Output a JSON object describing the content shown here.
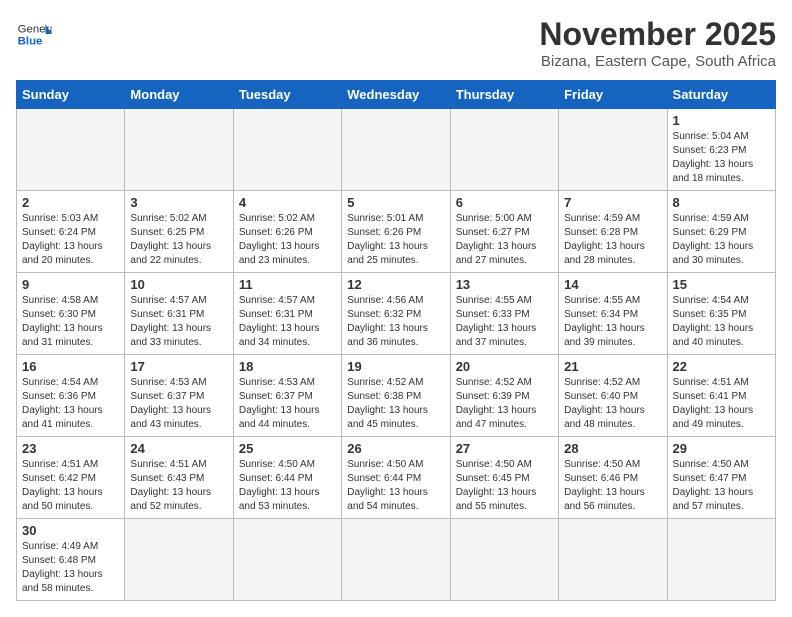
{
  "header": {
    "logo_text_general": "General",
    "logo_text_blue": "Blue",
    "month": "November 2025",
    "location": "Bizana, Eastern Cape, South Africa"
  },
  "days_of_week": [
    "Sunday",
    "Monday",
    "Tuesday",
    "Wednesday",
    "Thursday",
    "Friday",
    "Saturday"
  ],
  "weeks": [
    [
      {
        "day": "",
        "info": "",
        "empty": true
      },
      {
        "day": "",
        "info": "",
        "empty": true
      },
      {
        "day": "",
        "info": "",
        "empty": true
      },
      {
        "day": "",
        "info": "",
        "empty": true
      },
      {
        "day": "",
        "info": "",
        "empty": true
      },
      {
        "day": "",
        "info": "",
        "empty": true
      },
      {
        "day": "1",
        "info": "Sunrise: 5:04 AM\nSunset: 6:23 PM\nDaylight: 13 hours and 18 minutes."
      }
    ],
    [
      {
        "day": "2",
        "info": "Sunrise: 5:03 AM\nSunset: 6:24 PM\nDaylight: 13 hours and 20 minutes."
      },
      {
        "day": "3",
        "info": "Sunrise: 5:02 AM\nSunset: 6:25 PM\nDaylight: 13 hours and 22 minutes."
      },
      {
        "day": "4",
        "info": "Sunrise: 5:02 AM\nSunset: 6:26 PM\nDaylight: 13 hours and 23 minutes."
      },
      {
        "day": "5",
        "info": "Sunrise: 5:01 AM\nSunset: 6:26 PM\nDaylight: 13 hours and 25 minutes."
      },
      {
        "day": "6",
        "info": "Sunrise: 5:00 AM\nSunset: 6:27 PM\nDaylight: 13 hours and 27 minutes."
      },
      {
        "day": "7",
        "info": "Sunrise: 4:59 AM\nSunset: 6:28 PM\nDaylight: 13 hours and 28 minutes."
      },
      {
        "day": "8",
        "info": "Sunrise: 4:59 AM\nSunset: 6:29 PM\nDaylight: 13 hours and 30 minutes."
      }
    ],
    [
      {
        "day": "9",
        "info": "Sunrise: 4:58 AM\nSunset: 6:30 PM\nDaylight: 13 hours and 31 minutes."
      },
      {
        "day": "10",
        "info": "Sunrise: 4:57 AM\nSunset: 6:31 PM\nDaylight: 13 hours and 33 minutes."
      },
      {
        "day": "11",
        "info": "Sunrise: 4:57 AM\nSunset: 6:31 PM\nDaylight: 13 hours and 34 minutes."
      },
      {
        "day": "12",
        "info": "Sunrise: 4:56 AM\nSunset: 6:32 PM\nDaylight: 13 hours and 36 minutes."
      },
      {
        "day": "13",
        "info": "Sunrise: 4:55 AM\nSunset: 6:33 PM\nDaylight: 13 hours and 37 minutes."
      },
      {
        "day": "14",
        "info": "Sunrise: 4:55 AM\nSunset: 6:34 PM\nDaylight: 13 hours and 39 minutes."
      },
      {
        "day": "15",
        "info": "Sunrise: 4:54 AM\nSunset: 6:35 PM\nDaylight: 13 hours and 40 minutes."
      }
    ],
    [
      {
        "day": "16",
        "info": "Sunrise: 4:54 AM\nSunset: 6:36 PM\nDaylight: 13 hours and 41 minutes."
      },
      {
        "day": "17",
        "info": "Sunrise: 4:53 AM\nSunset: 6:37 PM\nDaylight: 13 hours and 43 minutes."
      },
      {
        "day": "18",
        "info": "Sunrise: 4:53 AM\nSunset: 6:37 PM\nDaylight: 13 hours and 44 minutes."
      },
      {
        "day": "19",
        "info": "Sunrise: 4:52 AM\nSunset: 6:38 PM\nDaylight: 13 hours and 45 minutes."
      },
      {
        "day": "20",
        "info": "Sunrise: 4:52 AM\nSunset: 6:39 PM\nDaylight: 13 hours and 47 minutes."
      },
      {
        "day": "21",
        "info": "Sunrise: 4:52 AM\nSunset: 6:40 PM\nDaylight: 13 hours and 48 minutes."
      },
      {
        "day": "22",
        "info": "Sunrise: 4:51 AM\nSunset: 6:41 PM\nDaylight: 13 hours and 49 minutes."
      }
    ],
    [
      {
        "day": "23",
        "info": "Sunrise: 4:51 AM\nSunset: 6:42 PM\nDaylight: 13 hours and 50 minutes."
      },
      {
        "day": "24",
        "info": "Sunrise: 4:51 AM\nSunset: 6:43 PM\nDaylight: 13 hours and 52 minutes."
      },
      {
        "day": "25",
        "info": "Sunrise: 4:50 AM\nSunset: 6:44 PM\nDaylight: 13 hours and 53 minutes."
      },
      {
        "day": "26",
        "info": "Sunrise: 4:50 AM\nSunset: 6:44 PM\nDaylight: 13 hours and 54 minutes."
      },
      {
        "day": "27",
        "info": "Sunrise: 4:50 AM\nSunset: 6:45 PM\nDaylight: 13 hours and 55 minutes."
      },
      {
        "day": "28",
        "info": "Sunrise: 4:50 AM\nSunset: 6:46 PM\nDaylight: 13 hours and 56 minutes."
      },
      {
        "day": "29",
        "info": "Sunrise: 4:50 AM\nSunset: 6:47 PM\nDaylight: 13 hours and 57 minutes."
      }
    ],
    [
      {
        "day": "30",
        "info": "Sunrise: 4:49 AM\nSunset: 6:48 PM\nDaylight: 13 hours and 58 minutes."
      },
      {
        "day": "",
        "info": "",
        "empty": true
      },
      {
        "day": "",
        "info": "",
        "empty": true
      },
      {
        "day": "",
        "info": "",
        "empty": true
      },
      {
        "day": "",
        "info": "",
        "empty": true
      },
      {
        "day": "",
        "info": "",
        "empty": true
      },
      {
        "day": "",
        "info": "",
        "empty": true
      }
    ]
  ]
}
